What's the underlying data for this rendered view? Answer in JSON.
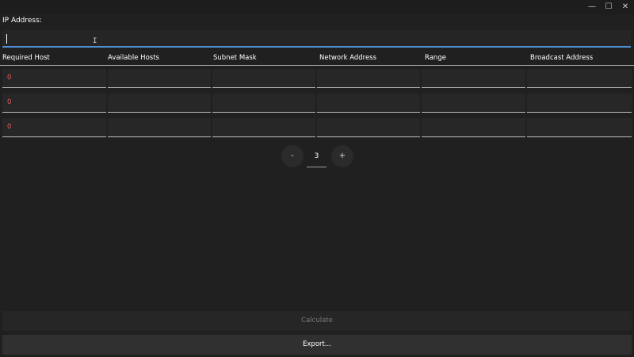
{
  "window": {
    "controls": {
      "minimize": "—",
      "maximize": "☐",
      "close": "✕"
    }
  },
  "ip": {
    "label": "IP Address:",
    "value": "",
    "cursor": "I"
  },
  "table": {
    "headers": [
      "Required Host",
      "Available Hosts",
      "Subnet Mask",
      "Network Address",
      "Range",
      "Broadcast Address"
    ],
    "rows": [
      [
        "0",
        "",
        "",
        "",
        "",
        ""
      ],
      [
        "0",
        "",
        "",
        "",
        "",
        ""
      ],
      [
        "0",
        "",
        "",
        "",
        "",
        ""
      ]
    ]
  },
  "stepper": {
    "minus": "-",
    "value": "3",
    "plus": "+"
  },
  "actions": {
    "calculate": "Calculate",
    "export": "Export..."
  },
  "colors": {
    "background": "#202020",
    "accent": "#4f8fd4",
    "required_value": "#e05c5c"
  }
}
